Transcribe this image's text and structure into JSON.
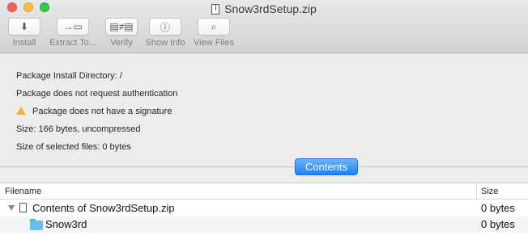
{
  "window": {
    "title": "Snow3rdSetup.zip"
  },
  "toolbar": [
    {
      "label": "Install",
      "icon": "download-arrow-icon"
    },
    {
      "label": "Extract To...",
      "icon": "extract-folder-icon"
    },
    {
      "label": "Verify",
      "icon": "verify-icon"
    },
    {
      "label": "Show Info",
      "icon": "info-icon"
    },
    {
      "label": "View Files",
      "icon": "magnifier-icon"
    }
  ],
  "info": {
    "install_dir": "Package Install Directory: /",
    "auth": "Package does not request authentication",
    "signature": "Package does not have a signature",
    "size": "Size: 166 bytes, uncompressed",
    "selected": "Size of selected files: 0 bytes"
  },
  "contents_button": "Contents",
  "table": {
    "columns": {
      "name": "Filename",
      "size": "Size"
    },
    "rows": [
      {
        "name": "Contents of Snow3rdSetup.zip",
        "size": "0 bytes"
      },
      {
        "name": "Snow3rd",
        "size": "0 bytes"
      }
    ]
  },
  "colors": {
    "accent": "#1a82fb",
    "warning": "#e6b73a",
    "folder": "#6dbcf0"
  }
}
